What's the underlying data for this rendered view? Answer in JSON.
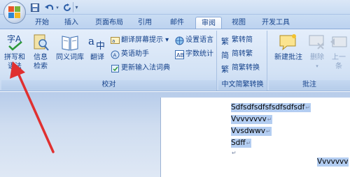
{
  "quick_access": {
    "save_icon": "save-icon",
    "undo_icon": "undo-icon",
    "redo_icon": "redo-icon",
    "customize_icon": "customize-qat-icon"
  },
  "tabs": [
    "开始",
    "插入",
    "页面布局",
    "引用",
    "邮件",
    "审阅",
    "视图",
    "开发工具"
  ],
  "active_tab": "审阅",
  "groups": {
    "proofing": {
      "label": "校对",
      "spelling": {
        "line1": "拼写和",
        "line2": "语法"
      },
      "research": {
        "line1": "信息",
        "line2": "检索"
      },
      "thesaurus": "同义词库",
      "translate": "翻译",
      "translate_screentip": "翻译屏幕提示 ▾",
      "english_assistant": "英语助手",
      "update_ime": "更新输入法词典",
      "set_language": "设置语言",
      "word_count": "字数统计"
    },
    "chinese_conversion": {
      "label": "中文简繁转换",
      "to_simplified": "繁转简",
      "to_traditional": "简转繁",
      "conversion": "简繁转换"
    },
    "comments": {
      "label": "批注",
      "new_comment": "新建批注",
      "delete": "删除",
      "previous": {
        "line1": "上一",
        "line2": "条"
      }
    }
  },
  "document": {
    "lines": [
      "Sdfsdfsdfsfsdfsdfsdf",
      "Vvvvvvvv",
      "Vvsdwwv",
      "Sdff",
      "Vvvvvvv"
    ],
    "paragraph_mark": "↵"
  },
  "colors": {
    "ribbon_text": "#15428b",
    "selection": "#b3cdf1",
    "arrow": "#e03030"
  }
}
